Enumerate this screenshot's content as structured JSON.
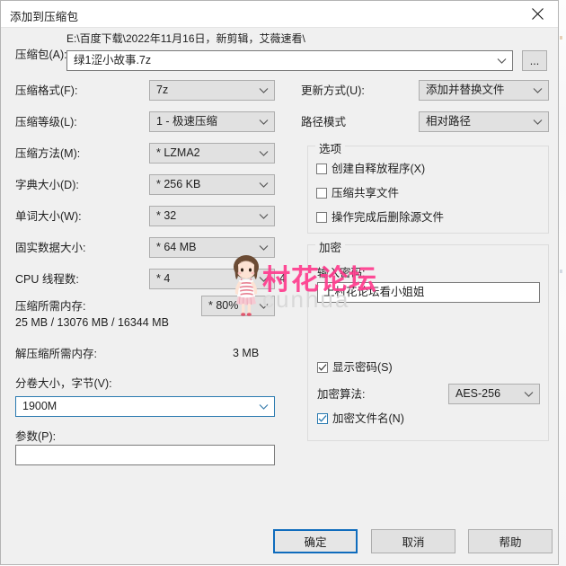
{
  "window": {
    "title": "添加到压缩包",
    "close_icon": "close-icon"
  },
  "archive": {
    "label": "压缩包(A):",
    "path": "E:\\百度下载\\2022年11月16日，新剪辑，艾薇速看\\",
    "filename": "绿1涩小故事.7z",
    "browse_label": "..."
  },
  "left": {
    "format_label": "压缩格式(F):",
    "format_value": "7z",
    "level_label": "压缩等级(L):",
    "level_value": "1 - 极速压缩",
    "method_label": "压缩方法(M):",
    "method_value": "*  LZMA2",
    "dict_label": "字典大小(D):",
    "dict_value": "*  256 KB",
    "word_label": "单词大小(W):",
    "word_value": "*  32",
    "solid_label": "固实数据大小:",
    "solid_value": "*  64 MB",
    "cpu_label": "CPU 线程数:",
    "cpu_value": "*  4",
    "cpu_total": "4",
    "mem_compress_label": "压缩所需内存:",
    "mem_compress_value": "25 MB / 13076 MB / 16344 MB",
    "mem_percent": "*  80%",
    "mem_decompress_label": "解压缩所需内存:",
    "mem_decompress_value": "3 MB",
    "volume_label": "分卷大小，字节(V):",
    "volume_value": "1900M",
    "params_label": "参数(P):",
    "params_value": ""
  },
  "right": {
    "update_label": "更新方式(U):",
    "update_value": "添加并替换文件",
    "pathmode_label": "路径模式",
    "pathmode_value": "相对路径",
    "options_group": "选项",
    "options": [
      {
        "label": "创建自释放程序(X)",
        "accel": "X",
        "checked": false
      },
      {
        "label": "压缩共享文件",
        "accel": "",
        "checked": false
      },
      {
        "label": "操作完成后删除源文件",
        "accel": "",
        "checked": false
      }
    ],
    "encrypt_group": "加密",
    "password_label": "输入密码:",
    "password_value": "上村花论坛看小姐姐",
    "show_password_label": "显示密码(S)",
    "show_password_checked": true,
    "algo_label": "加密算法:",
    "algo_value": "AES-256",
    "encrypt_names_label": "加密文件名(N)",
    "encrypt_names_checked": true
  },
  "footer": {
    "ok": "确定",
    "cancel": "取消",
    "help": "帮助"
  },
  "watermark": {
    "text": "村花论坛",
    "sub": "cunhua",
    "color": "#ff3c8e"
  },
  "colors": {
    "accent": "#0f6cbd",
    "dialog_bg": "#f0f0f0",
    "field_bg": "#e1e1e1",
    "focus_border": "#2a7ab0"
  }
}
